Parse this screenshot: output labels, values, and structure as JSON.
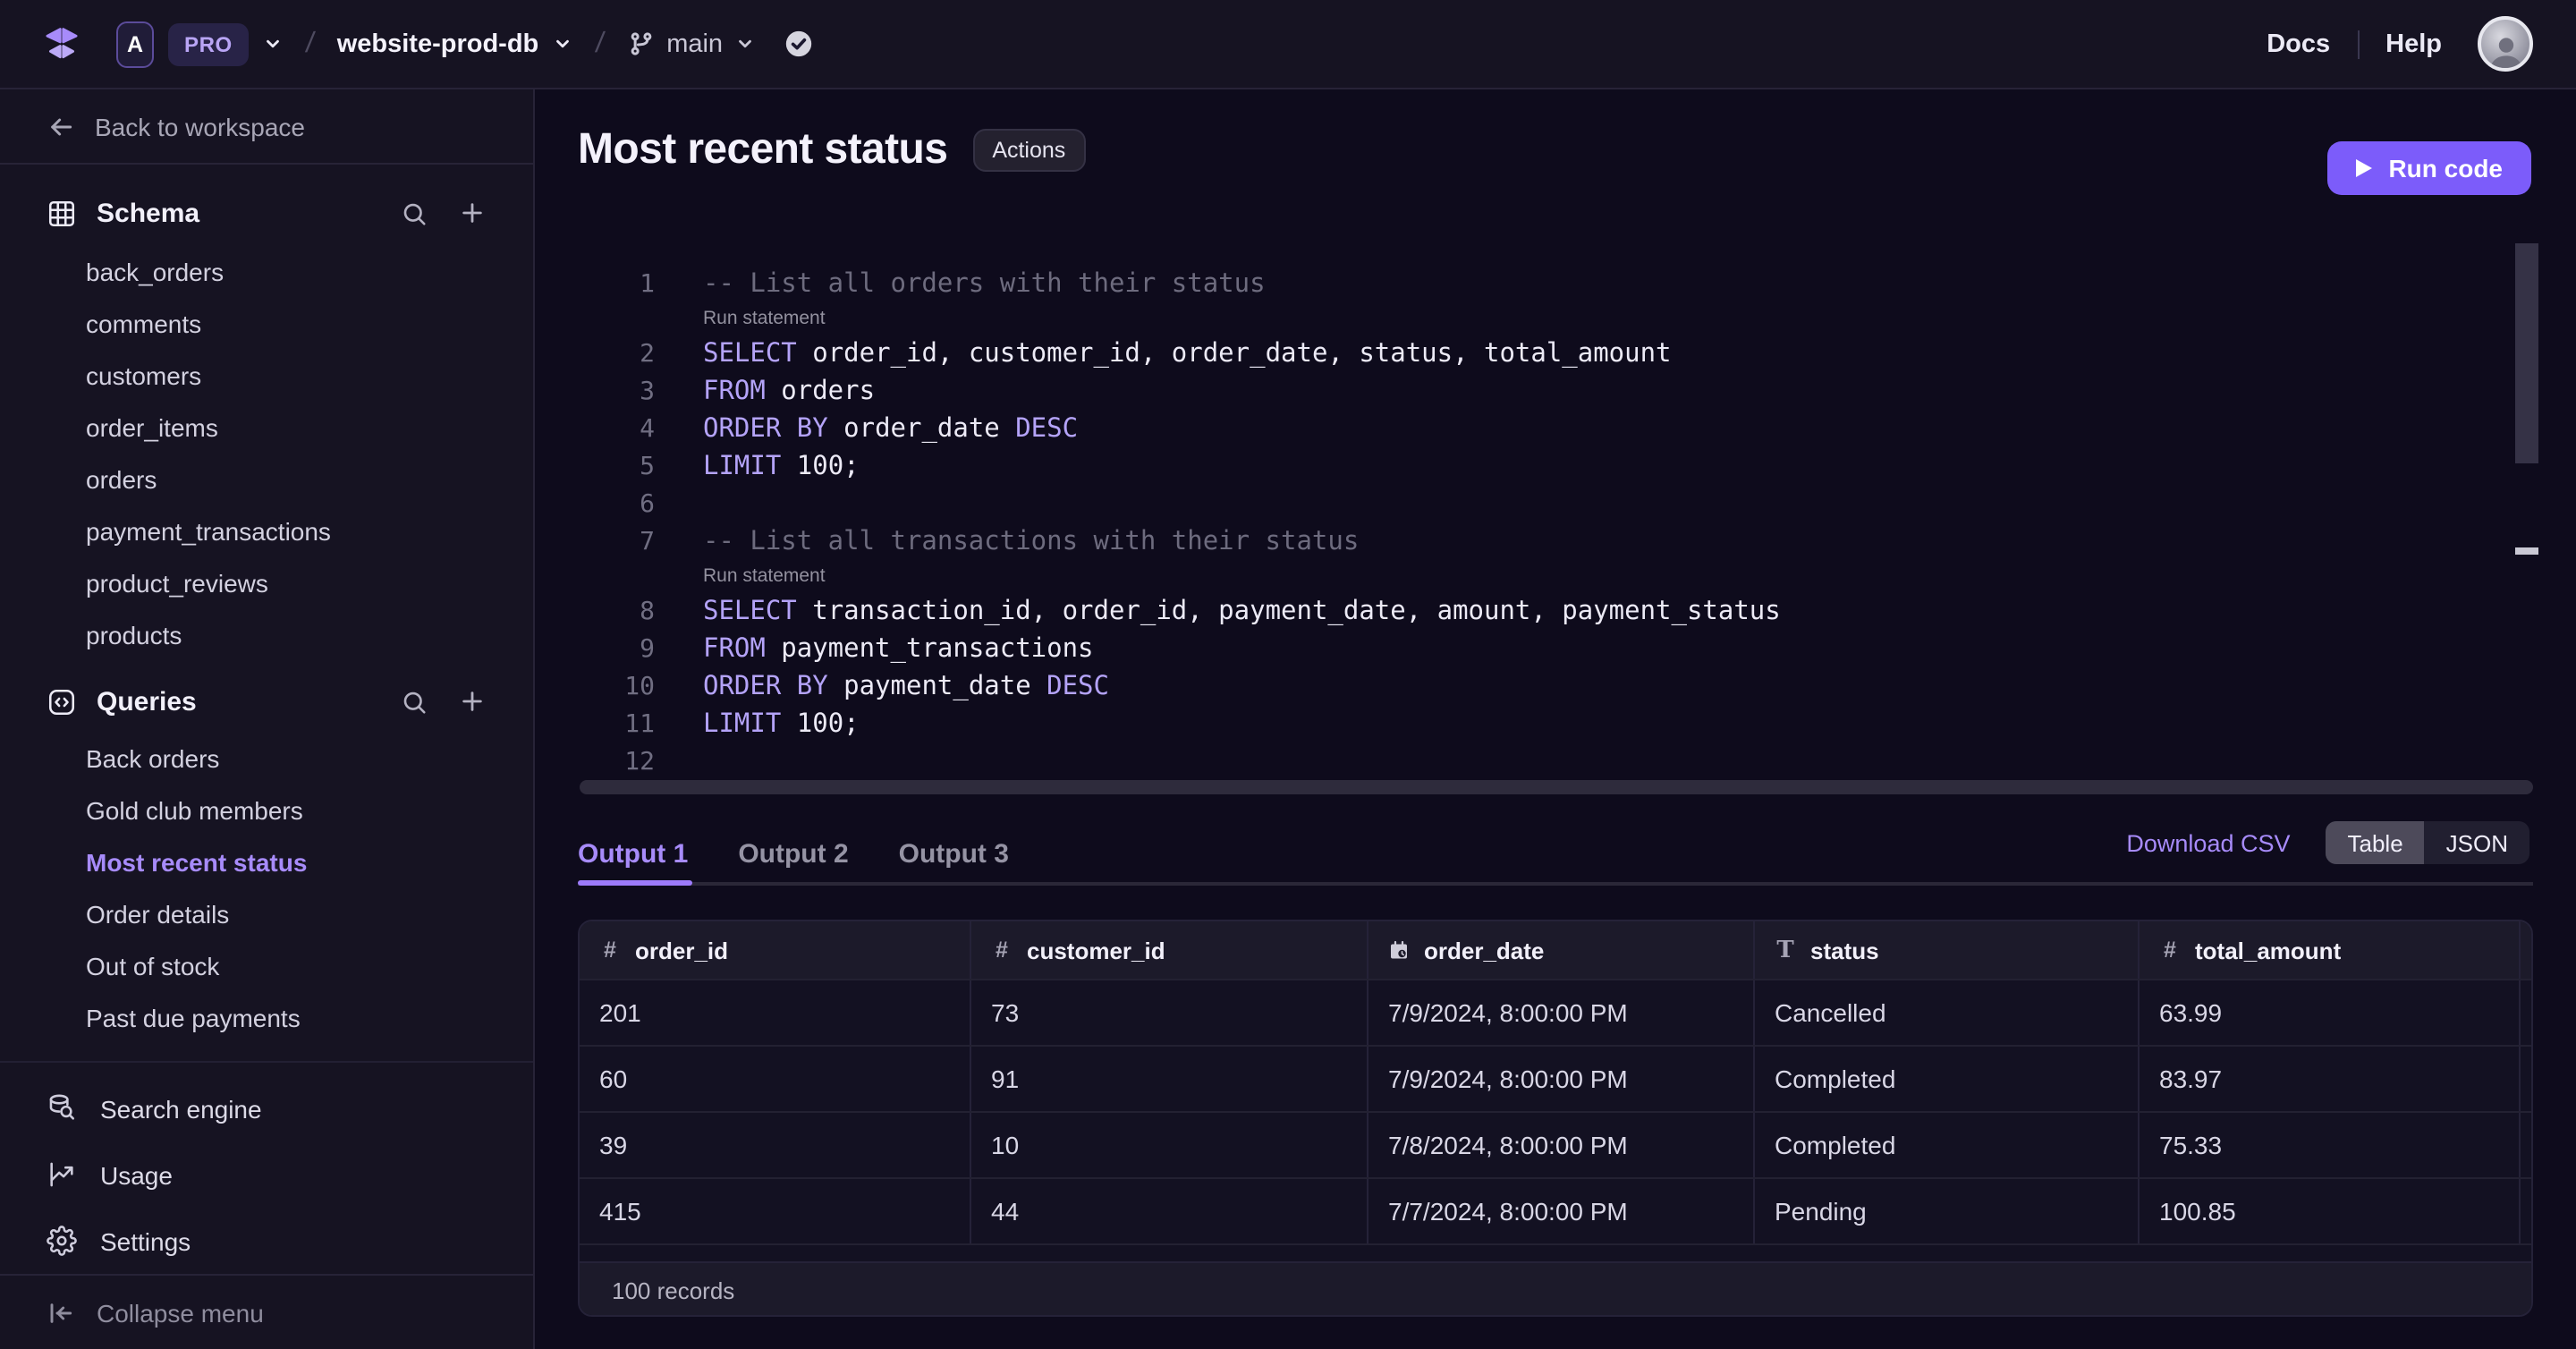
{
  "topbar": {
    "workspace_badge": "A",
    "plan_badge": "PRO",
    "breadcrumb_separator": "/",
    "database_name": "website-prod-db",
    "branch_name": "main",
    "docs_label": "Docs",
    "help_label": "Help"
  },
  "sidebar": {
    "back_label": "Back to workspace",
    "schema": {
      "title": "Schema",
      "items": [
        "back_orders",
        "comments",
        "customers",
        "order_items",
        "orders",
        "payment_transactions",
        "product_reviews",
        "products"
      ]
    },
    "queries": {
      "title": "Queries",
      "items": [
        "Back orders",
        "Gold club members",
        "Most recent status",
        "Order details",
        "Out of stock",
        "Past due payments"
      ],
      "active_item": "Most recent status"
    },
    "footer_items": [
      {
        "label": "Search engine",
        "icon": "database-search"
      },
      {
        "label": "Usage",
        "icon": "usage-chart"
      },
      {
        "label": "Settings",
        "icon": "gear"
      }
    ],
    "collapse_label": "Collapse menu"
  },
  "main": {
    "title": "Most recent status",
    "actions_label": "Actions",
    "run_button_label": "Run code",
    "editor": {
      "widget_label": "Run statement",
      "lines": [
        {
          "n": 1,
          "widget_after": true,
          "tokens": [
            {
              "c": "cm",
              "t": "-- List all orders with their status"
            }
          ]
        },
        {
          "n": 2,
          "tokens": [
            {
              "c": "kw",
              "t": "SELECT"
            },
            {
              "c": "pl",
              "t": " order_id, customer_id, order_date, status, total_amount"
            }
          ]
        },
        {
          "n": 3,
          "tokens": [
            {
              "c": "kw",
              "t": "FROM"
            },
            {
              "c": "pl",
              "t": " orders"
            }
          ]
        },
        {
          "n": 4,
          "tokens": [
            {
              "c": "kw",
              "t": "ORDER BY"
            },
            {
              "c": "pl",
              "t": " order_date "
            },
            {
              "c": "kw",
              "t": "DESC"
            }
          ]
        },
        {
          "n": 5,
          "tokens": [
            {
              "c": "kw",
              "t": "LIMIT"
            },
            {
              "c": "pl",
              "t": " 100;"
            }
          ]
        },
        {
          "n": 6,
          "tokens": []
        },
        {
          "n": 7,
          "widget_after": true,
          "tokens": [
            {
              "c": "cm",
              "t": "-- List all transactions with their status"
            }
          ]
        },
        {
          "n": 8,
          "tokens": [
            {
              "c": "kw",
              "t": "SELECT"
            },
            {
              "c": "pl",
              "t": " transaction_id, order_id, payment_date, amount, payment_status"
            }
          ]
        },
        {
          "n": 9,
          "tokens": [
            {
              "c": "kw",
              "t": "FROM"
            },
            {
              "c": "pl",
              "t": " payment_transactions"
            }
          ]
        },
        {
          "n": 10,
          "tokens": [
            {
              "c": "kw",
              "t": "ORDER BY"
            },
            {
              "c": "pl",
              "t": " payment_date "
            },
            {
              "c": "kw",
              "t": "DESC"
            }
          ]
        },
        {
          "n": 11,
          "tokens": [
            {
              "c": "kw",
              "t": "LIMIT"
            },
            {
              "c": "pl",
              "t": " 100;"
            }
          ]
        },
        {
          "n": 12,
          "tokens": []
        }
      ]
    },
    "output": {
      "tabs": [
        "Output 1",
        "Output 2",
        "Output 3"
      ],
      "active_tab": "Output 1",
      "download_label": "Download CSV",
      "view_options": [
        "Table",
        "JSON"
      ],
      "active_view": "Table"
    },
    "table": {
      "columns": [
        {
          "label": "order_id",
          "type": "number"
        },
        {
          "label": "customer_id",
          "type": "number"
        },
        {
          "label": "order_date",
          "type": "date"
        },
        {
          "label": "status",
          "type": "text"
        },
        {
          "label": "total_amount",
          "type": "number"
        }
      ],
      "rows": [
        [
          "201",
          "73",
          "7/9/2024, 8:00:00 PM",
          "Cancelled",
          "63.99"
        ],
        [
          "60",
          "91",
          "7/9/2024, 8:00:00 PM",
          "Completed",
          "83.97"
        ],
        [
          "39",
          "10",
          "7/8/2024, 8:00:00 PM",
          "Completed",
          "75.33"
        ],
        [
          "415",
          "44",
          "7/7/2024, 8:00:00 PM",
          "Pending",
          "100.85"
        ]
      ],
      "record_count": "100 records"
    }
  },
  "colors": {
    "accent_button": "#7c5cfa",
    "active_link": "#a78bfa",
    "keyword": "#b4a3f8",
    "main_background": "#0e0b1c",
    "panel_background": "#161322"
  }
}
